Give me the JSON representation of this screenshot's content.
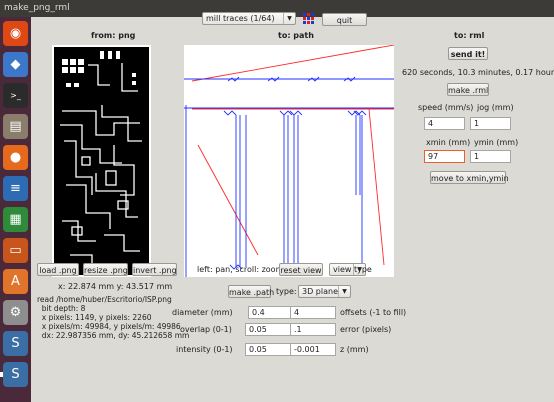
{
  "window": {
    "title": "make_png_rml"
  },
  "launcher": {
    "items": [
      {
        "icon": "ubuntu-dash-icon",
        "bg": "#dd4814",
        "glyph": "◉"
      },
      {
        "icon": "dropbox-icon",
        "bg": "#3d77c9",
        "glyph": "◆"
      },
      {
        "icon": "terminal-icon",
        "bg": "#2b2b2b",
        "glyph": ">_"
      },
      {
        "icon": "file-manager-icon",
        "bg": "#8a7d6b",
        "glyph": "▤"
      },
      {
        "icon": "firefox-icon",
        "bg": "#e66a1e",
        "glyph": "●"
      },
      {
        "icon": "writer-icon",
        "bg": "#2d6cb5",
        "glyph": "≡"
      },
      {
        "icon": "calc-icon",
        "bg": "#2f8b3a",
        "glyph": "▦"
      },
      {
        "icon": "impress-icon",
        "bg": "#c8551b",
        "glyph": "▭"
      },
      {
        "icon": "software-center-icon",
        "bg": "#e0742a",
        "glyph": "A"
      },
      {
        "icon": "settings-icon",
        "bg": "#8e8e8e",
        "glyph": "⚙"
      },
      {
        "icon": "python-icon",
        "bg": "#3a6ea5",
        "glyph": "S"
      },
      {
        "icon": "python-icon-2",
        "bg": "#3a6ea5",
        "glyph": "S"
      }
    ]
  },
  "top": {
    "process": "mill traces (1/64)",
    "quit": "quit"
  },
  "png": {
    "header": "from: png",
    "load": "load .png",
    "resize": "resize .png",
    "invert": "invert .png",
    "coords": "x: 22.874 mm  y: 43.517 mm",
    "info": [
      "read /home/huber/Escritorio/ISP.png",
      "  bit depth: 8",
      "  x pixels: 1149, y pixels: 2260",
      "  x pixels/m: 49984, y pixels/m: 49986",
      "  dx: 22.987356 mm, dy: 45.212658 mm"
    ]
  },
  "path": {
    "header": "to: path",
    "hint": "left: pan, scroll: zoom",
    "reset": "reset view",
    "view_type": "view type",
    "make": "make .path",
    "type_label": "type:",
    "type_value": "3D plane",
    "diameter_label": "diameter (mm)",
    "diameter": "0.4",
    "offsets_label": "offsets (-1 to fill)",
    "offsets": "4",
    "overlap_label": "overlap (0-1)",
    "overlap": "0.05",
    "error_label": "error (pixels)",
    "error": ".1",
    "intensity_label": "intensity (0-1)",
    "intensity": "0.05",
    "z": "-0.001",
    "z_label": "z (mm)"
  },
  "rml": {
    "header": "to: rml",
    "send": "send it!",
    "time": "620 seconds, 10.3 minutes, 0.17 hours",
    "make": "make .rml",
    "speed_label": "speed (mm/s)",
    "speed": "4",
    "jog_label": "jog (mm)",
    "jog": "1",
    "xmin_label": "xmin (mm)",
    "xmin": "97",
    "ymin_label": "ymin (mm)",
    "ymin": "1",
    "move": "move to xmin,ymin"
  },
  "colors": {
    "path_blue": "#2030ff",
    "move_red": "#ff2a2a",
    "launcher": "#4a2a3a"
  }
}
